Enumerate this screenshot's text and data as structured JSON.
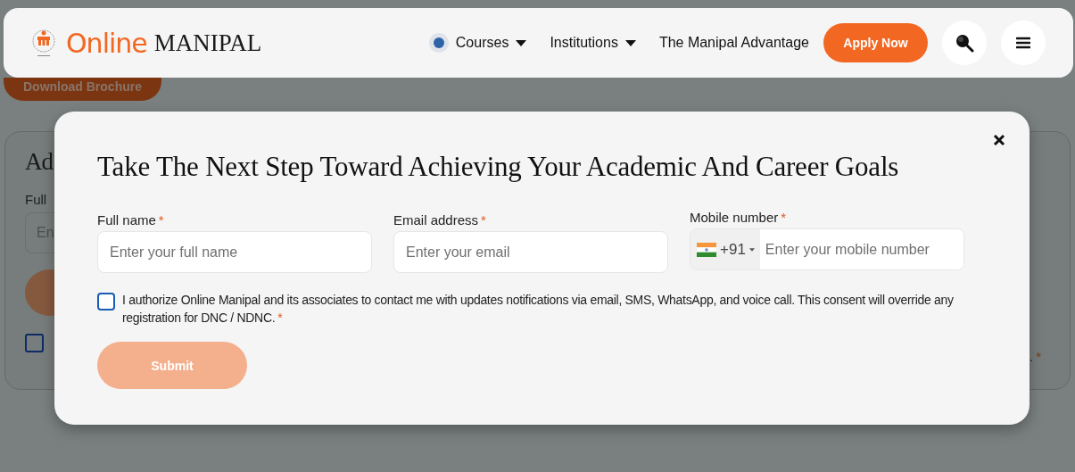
{
  "backdrop": {
    "brochure_button": "Download Brochure",
    "form_card": {
      "heading": "Ad",
      "label": "Full",
      "placeholder": "En",
      "checkbox_checked": false,
      "consent_tail": ".",
      "required_mark": "*"
    }
  },
  "header": {
    "logo": {
      "word_1": "Online",
      "word_2": "MANIPAL"
    },
    "nav": [
      {
        "label": "Courses",
        "kind": "dropdown",
        "dot": true
      },
      {
        "label": "Institutions",
        "kind": "dropdown",
        "dot": false
      },
      {
        "label": "The Manipal Advantage",
        "kind": "link",
        "dot": false
      }
    ],
    "apply_button": "Apply Now"
  },
  "modal": {
    "title": "Take The Next Step Toward Achieving Your Academic And Career Goals",
    "fields": [
      {
        "kind": "text",
        "label": "Full name",
        "required_mark": "*",
        "placeholder": "Enter your full name"
      },
      {
        "kind": "text",
        "label": "Email address",
        "required_mark": "*",
        "placeholder": "Enter your email"
      },
      {
        "kind": "phone",
        "label": "Mobile number",
        "required_mark": "*",
        "country_code": "+91",
        "placeholder": "Enter your mobile number"
      }
    ],
    "consent": {
      "checked": false,
      "text": "I authorize Online Manipal and its associates to contact me with updates notifications via email, SMS, WhatsApp, and voice call. This consent will override any registration for DNC / NDNC.",
      "required_mark": "*"
    },
    "submit_button": "Submit",
    "submit_disabled": true
  }
}
